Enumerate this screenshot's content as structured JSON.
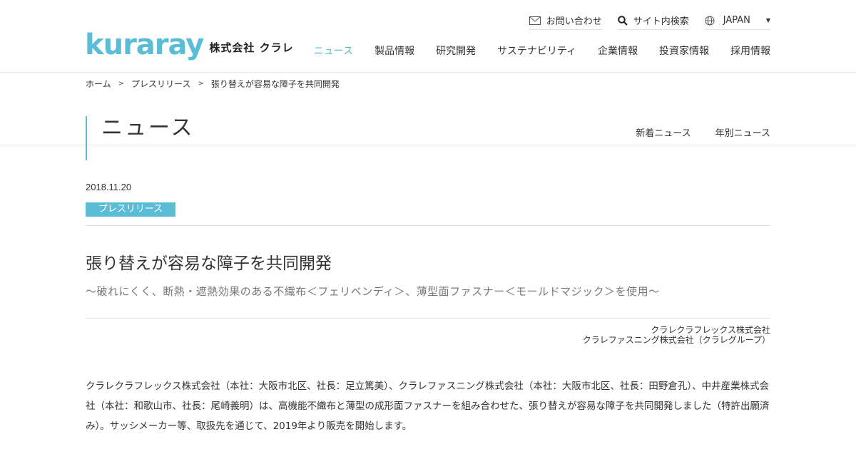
{
  "header": {
    "logo_text": "kuraray",
    "logo_subtitle": "株式会社 クラレ",
    "utility": {
      "contact_label": "お問い合わせ",
      "search_label": "サイト内検索",
      "region_label": "JAPAN"
    },
    "nav": [
      {
        "label": "ニュース",
        "active": true
      },
      {
        "label": "製品情報",
        "active": false
      },
      {
        "label": "研究開発",
        "active": false
      },
      {
        "label": "サステナビリティ",
        "active": false
      },
      {
        "label": "企業情報",
        "active": false
      },
      {
        "label": "投資家情報",
        "active": false
      },
      {
        "label": "採用情報",
        "active": false
      }
    ]
  },
  "breadcrumb": {
    "items": [
      "ホーム",
      "プレスリリース",
      "張り替えが容易な障子を共同開発"
    ],
    "separator": ">"
  },
  "page": {
    "title": "ニュース",
    "sub_nav": [
      "新着ニュース",
      "年別ニュース"
    ]
  },
  "article": {
    "date": "2018.11.20",
    "category": "プレスリリース",
    "title": "張り替えが容易な障子を共同開発",
    "subtitle": "～破れにくく、断熱・遮熱効果のある不織布＜フェリベンディ＞、薄型面ファスナー＜モールドマジック＞を使用～",
    "companies": [
      "クラレクラフレックス株式会社",
      "クラレファスニング株式会社（クラレグループ）"
    ],
    "body": "クラレクラフレックス株式会社（本社：大阪市北区、社長：足立篤美）、クラレファスニング株式会社（本社：大阪市北区、社長：田野倉孔）、中井産業株式会社（本社：和歌山市、社長：尾崎義明）は、高機能不織布と薄型の成形面ファスナーを組み合わせた、張り替えが容易な障子を共同開発しました（特許出願済み）。サッシメーカー等、取扱先を通じて、2019年より販売を開始します。"
  },
  "colors": {
    "accent": "#5bbcd6",
    "text": "#333333",
    "subtle_text": "#777777",
    "rule": "#dddddd"
  }
}
